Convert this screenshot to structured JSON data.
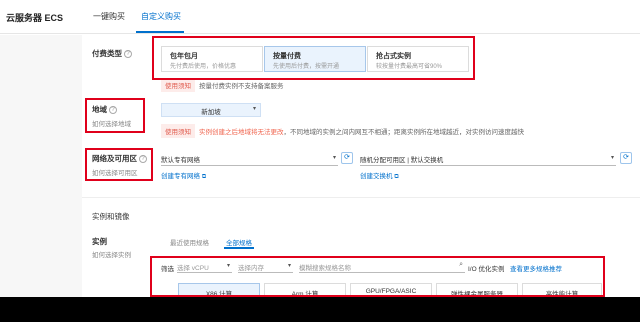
{
  "header": {
    "title": "云服务器 ECS",
    "tabs": [
      {
        "label": "一键购买"
      },
      {
        "label": "自定义购买"
      }
    ]
  },
  "billing": {
    "label": "付费类型",
    "options": [
      {
        "title": "包年包月",
        "desc": "先付费后使用，价格优惠"
      },
      {
        "title": "按量付费",
        "desc": "先使用后付费，按需开通"
      },
      {
        "title": "抢占式实例",
        "desc": "较按量付费最高可省90%"
      }
    ],
    "notice_badge": "使用须知",
    "notice_text": "按量付费实例不支持备案服务"
  },
  "region": {
    "label": "地域",
    "sublabel": "如何选择地域",
    "value": "新加坡",
    "notice_badge": "使用须知",
    "notice_text": "实例创建之后地域将无法更改",
    "notice_text2": "，不同地域的实例之间内网互不相通；距离实例所在地域越近，对实例访问速度越快"
  },
  "network": {
    "label": "网络及可用区",
    "sublabel": "如何选择可用区",
    "vpc_value": "默认专有网络",
    "vpc_link": "创建专有网络",
    "zone_value": "随机分配可用区 | 默认交换机",
    "zone_link": "创建交换机"
  },
  "instance_section": {
    "title": "实例和镜像",
    "instance_label": "实例",
    "instance_sublabel": "如何选择实例",
    "tabs": [
      {
        "label": "最近使用规格"
      },
      {
        "label": "全部规格"
      }
    ],
    "filter_label": "筛选",
    "vcpu_placeholder": "选择 vCPU",
    "mem_placeholder": "选择内存",
    "search_placeholder": "模糊搜索规格名称",
    "io_label": "I/O 优化实例",
    "more_link": "查看更多规格推荐",
    "arch_tabs": [
      {
        "label": "X86 计算"
      },
      {
        "label": "Arm 计算"
      },
      {
        "label": "GPU/FPGA/ASIC"
      },
      {
        "label": "弹性裸金属服务器"
      },
      {
        "label": "高性能计算"
      }
    ]
  },
  "colors": {
    "accent": "#0070cc",
    "annotation": "#e0001b"
  }
}
